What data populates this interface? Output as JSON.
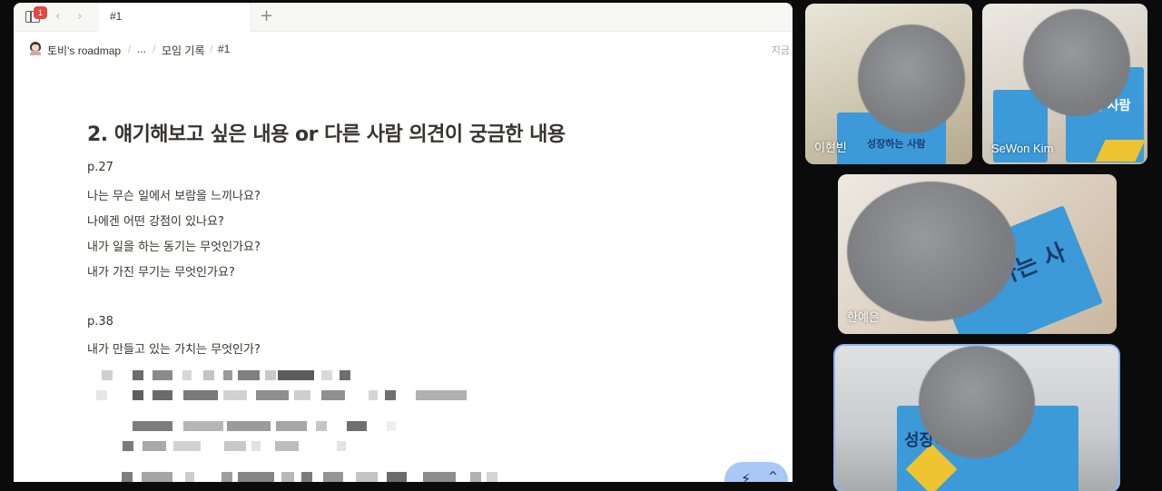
{
  "tabbar": {
    "notification_count": "1",
    "back_arrow": "‹",
    "forward_arrow": "›",
    "tab_title": "#1",
    "new_tab": "+"
  },
  "breadcrumb": {
    "workspace": "토비's roadmap",
    "ellipsis": "...",
    "parent": "모임 기록",
    "current": "#1",
    "edited_status": "지금"
  },
  "document": {
    "heading": "2. 얘기해보고 싶은 내용 or 다른 사람 의견이 궁금한 내용",
    "lines": [
      "p.27",
      "나는 무슨 일에서 보람을 느끼나요?",
      "나에겐 어떤 강점이 있나요?",
      "내가 일을 하는 동기는 무엇인가요?",
      "내가 가진 무기는 무엇인가요?",
      "p.38",
      "내가 만들고 있는 가치는 무엇인가?"
    ]
  },
  "fab": {
    "icon": "wand-icon",
    "chevron": "^"
  },
  "participants": [
    {
      "name": "이현빈",
      "book_title": "성장하는 사람"
    },
    {
      "name": "SeWon Kim",
      "book_title": "는 사람"
    },
    {
      "name": "한예은",
      "book_title": "장하는 사"
    },
    {
      "name": "",
      "book_title": "성장하는"
    }
  ],
  "colors": {
    "accent_blue": "#8ab4f8",
    "badge_red": "#e0493e",
    "book_blue": "#3d9ad9"
  }
}
